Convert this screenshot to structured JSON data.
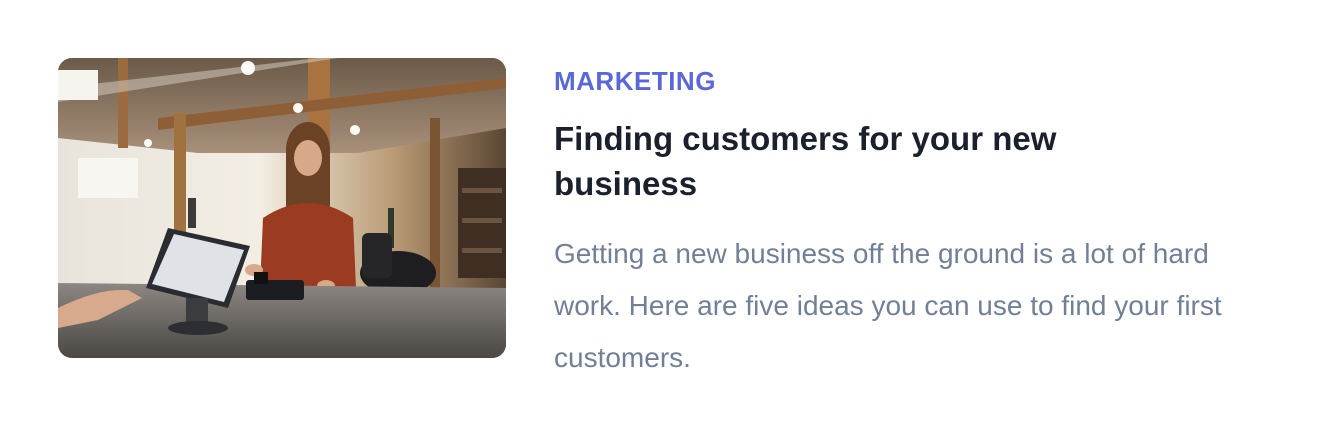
{
  "article": {
    "category": "MARKETING",
    "title": "Finding customers for your new business",
    "excerpt": "Getting a new business off the ground is a lot of hard work. Here are five ideas you can use to find your first customers.",
    "image_subject": "Woman at a point-of-sale counter in a bright loft office"
  },
  "colors": {
    "category": "#5a67d8",
    "title": "#1a202c",
    "excerpt": "#718096"
  }
}
